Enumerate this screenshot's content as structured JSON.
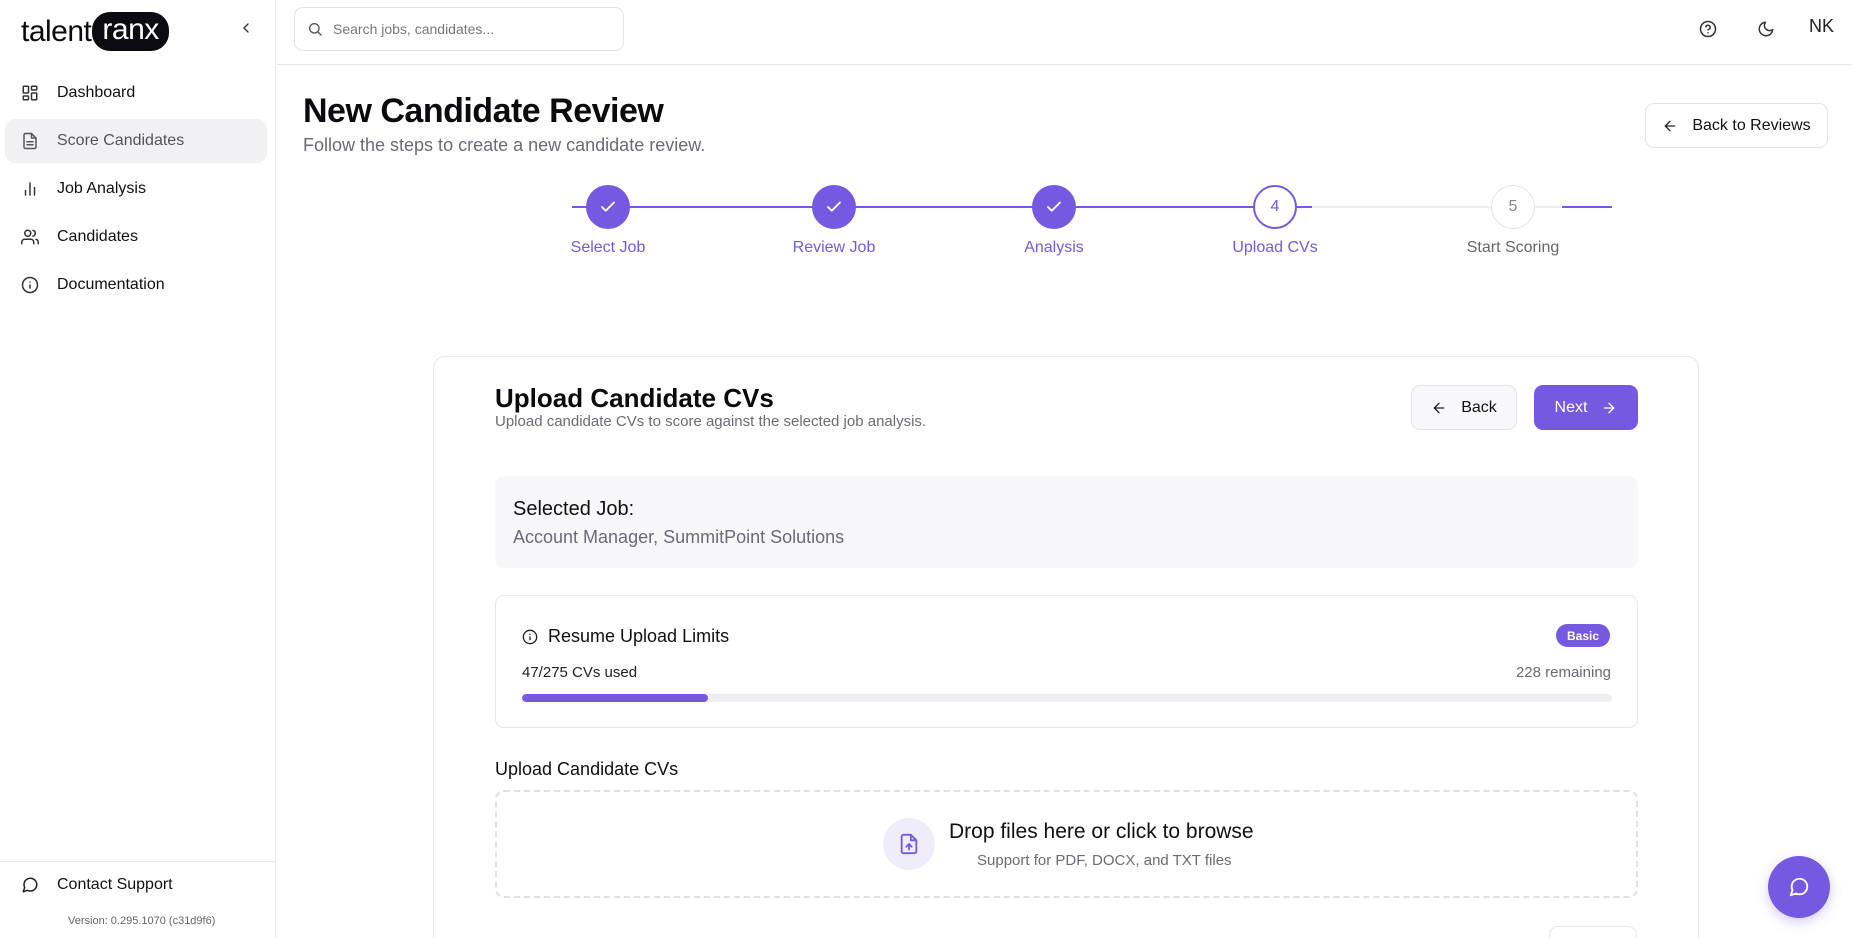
{
  "brand": {
    "name_prefix": "talent",
    "name_pill": "ranx"
  },
  "sidebar": {
    "items": [
      {
        "label": "Dashboard",
        "icon": "dashboard-icon",
        "active": false
      },
      {
        "label": "Score Candidates",
        "icon": "document-icon",
        "active": true
      },
      {
        "label": "Job Analysis",
        "icon": "bar-chart-icon",
        "active": false
      },
      {
        "label": "Candidates",
        "icon": "users-icon",
        "active": false
      },
      {
        "label": "Documentation",
        "icon": "info-icon",
        "active": false
      }
    ],
    "support_label": "Contact Support",
    "version": "Version: 0.295.1070 (c31d9f6)"
  },
  "topbar": {
    "search_placeholder": "Search jobs, candidates...",
    "avatar_initials": "NK"
  },
  "page": {
    "title": "New Candidate Review",
    "subtitle": "Follow the steps to create a new candidate review.",
    "back_to_reviews": "Back to Reviews"
  },
  "stepper": {
    "steps": [
      {
        "label": "Select Job",
        "number": "1",
        "state": "done"
      },
      {
        "label": "Review Job",
        "number": "2",
        "state": "done"
      },
      {
        "label": "Analysis",
        "number": "3",
        "state": "done"
      },
      {
        "label": "Upload CVs",
        "number": "4",
        "state": "current"
      },
      {
        "label": "Start Scoring",
        "number": "5",
        "state": "todo"
      }
    ]
  },
  "card": {
    "title": "Upload Candidate CVs",
    "subtitle": "Upload candidate CVs to score against the selected job analysis.",
    "back_label": "Back",
    "next_label": "Next",
    "selected_job_label": "Selected Job:",
    "selected_job_value": "Account Manager, SummitPoint Solutions",
    "limits": {
      "title": "Resume Upload Limits",
      "plan_badge": "Basic",
      "used_text": "47/275 CVs used",
      "remaining_text": "228 remaining",
      "used": 47,
      "total": 275
    },
    "upload_label": "Upload Candidate CVs",
    "dropzone_title": "Drop files here or click to browse",
    "dropzone_sub": "Support for PDF, DOCX, and TXT files"
  },
  "colors": {
    "accent": "#7559e0",
    "muted_text": "#6b6b75",
    "border": "#e5e5ea"
  }
}
